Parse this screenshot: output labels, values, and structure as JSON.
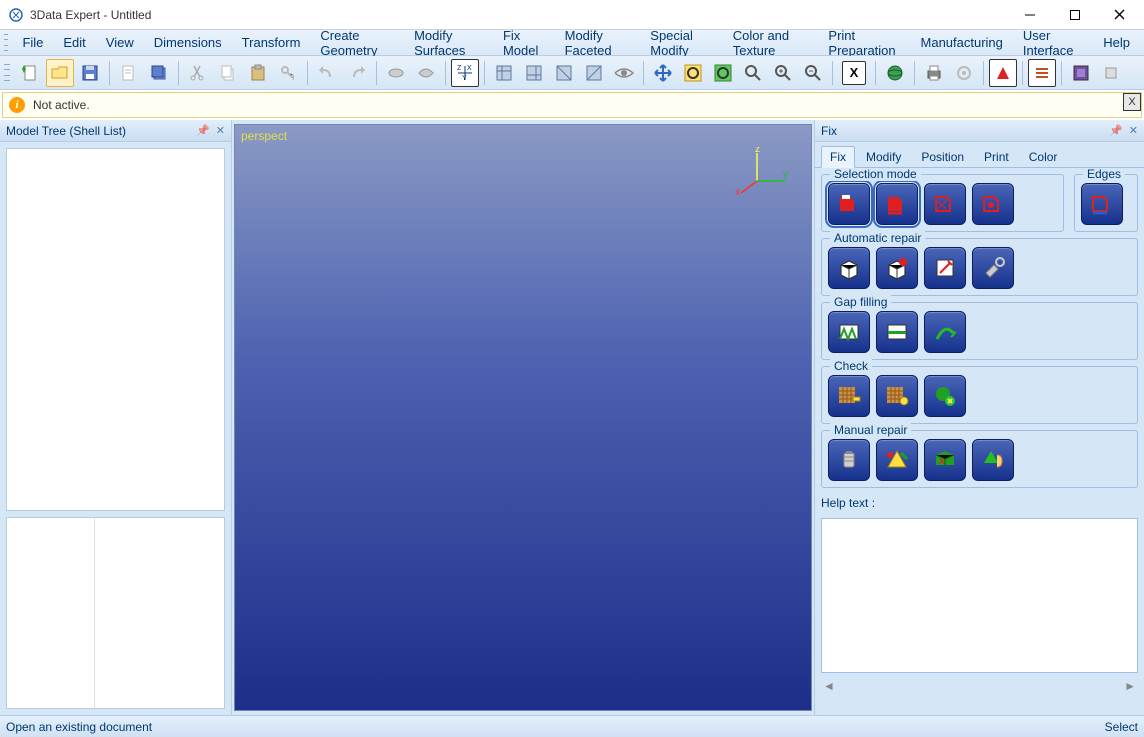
{
  "title": "3Data Expert - Untitled",
  "menus": [
    "File",
    "Edit",
    "View",
    "Dimensions",
    "Transform",
    "Create Geometry",
    "Modify Surfaces",
    "Fix Model",
    "Modify Faceted",
    "Special Modify",
    "Color and Texture",
    "Print Preparation",
    "Manufacturing",
    "User Interface",
    "Help"
  ],
  "message": "Not active.",
  "sidebar_title": "Model Tree (Shell List)",
  "viewport_label": "perspect",
  "fix_panel_title": "Fix",
  "fix_tabs": [
    "Fix",
    "Modify",
    "Position",
    "Print",
    "Color"
  ],
  "fix_tab_active": 0,
  "groups": {
    "selection_mode": "Selection mode",
    "edges": "Edges",
    "automatic_repair": "Automatic repair",
    "gap_filling": "Gap filling",
    "check": "Check",
    "manual_repair": "Manual repair"
  },
  "help_label": "Help text :",
  "status_left": "Open an existing document",
  "status_right": "Select",
  "axis": {
    "x": "x",
    "y": "y",
    "z": "z"
  },
  "boxed_btn": "X"
}
